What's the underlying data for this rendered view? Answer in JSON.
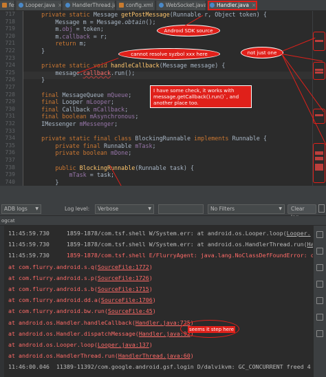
{
  "tabs": [
    {
      "label": "fest.xml",
      "icon": "xml-file-icon"
    },
    {
      "label": "Looper.java",
      "icon": "class-icon"
    },
    {
      "label": "HandlerThread.java",
      "icon": "class-icon"
    },
    {
      "label": "config.xml",
      "icon": "xml-file-icon"
    },
    {
      "label": "WebSocket.java",
      "icon": "class-icon"
    },
    {
      "label": "Handler.java",
      "icon": "class-icon",
      "active": true
    }
  ],
  "editor": {
    "line_numbers": [
      "717",
      "718",
      "719",
      "720",
      "721",
      "722",
      "723",
      "724",
      "725",
      "726",
      "727",
      "728",
      "729",
      "730",
      "731",
      "732",
      "733",
      "734",
      "735",
      "736",
      "737",
      "738",
      "739",
      "740"
    ],
    "lines": [
      [
        "    ",
        "kw:private static ",
        "Message ",
        "mth:getPostMessage",
        "(Runnable r, Object token) {"
      ],
      [
        "        Message m = Message.",
        "stat:obtain",
        "();"
      ],
      [
        "        m.",
        "fld:obj",
        " = token;"
      ],
      [
        "        m.",
        "fld:callback",
        " = r;"
      ],
      [
        "        ",
        "kw:return ",
        "m;"
      ],
      [
        "    }"
      ],
      [
        ""
      ],
      [
        "    ",
        "kw:private static void ",
        "mth:handleCallback",
        "(Message message) {"
      ],
      [
        "        message.",
        "err:callback",
        ".run();"
      ],
      [
        "    }"
      ],
      [
        ""
      ],
      [
        "    ",
        "kw:final ",
        "MessageQueue ",
        "fld:mQueue",
        ";"
      ],
      [
        "    ",
        "kw:final ",
        "Looper ",
        "fld:mLooper",
        ";"
      ],
      [
        "    ",
        "kw:final ",
        "Callback ",
        "fld:mCallback",
        ";"
      ],
      [
        "    ",
        "kw:final boolean ",
        "fld:mAsynchronous",
        ";"
      ],
      [
        "    IMessenger ",
        "fld:mMessenger",
        ";"
      ],
      [
        ""
      ],
      [
        "    ",
        "kw:private static final class ",
        "BlockingRunnable ",
        "kw:implements ",
        "Runnable {"
      ],
      [
        "        ",
        "kw:private final ",
        "Runnable ",
        "fld:mTask",
        ";"
      ],
      [
        "        ",
        "kw:private boolean ",
        "fld:mDone",
        ";"
      ],
      [
        ""
      ],
      [
        "        ",
        "kw:public ",
        "mth:BlockingRunnable",
        "(Runnable task) {"
      ],
      [
        "            ",
        "fld:mTask",
        " = task;"
      ],
      [
        "        }"
      ]
    ]
  },
  "annotations": {
    "sdk_source": "Android SDK source",
    "cannot_resolve": "cannot resolve syzbol xxx here",
    "not_just_one": "not just one",
    "explanation": "I have some check, it works with message.getCallback().run()`, and another place too.",
    "step_here": "seems it step here"
  },
  "toolbar": {
    "device_combo": "ADB logs",
    "log_level_label": "Log level:",
    "log_level_value": "Verbose",
    "filter_value": "No Filters",
    "clear_button": "Clear log"
  },
  "logcat": {
    "header": "ogcat",
    "rows": [
      {
        "ts": "11:45:59.730",
        "text": "     1859-1878/com.tsf.shell W/System.err: at android.os.Looper.loop(",
        "link": "Looper.",
        "style": "plain"
      },
      {
        "ts": "11:45:59.730",
        "text": "     1859-1878/com.tsf.shell W/System.err: at android.os.HandlerThread.run(",
        "link": "Handler",
        "style": "plain"
      },
      {
        "ts": "11:45:59.730",
        "text": "     1859-1878/com.tsf.shell E/FlurryAgent: java.lang.NoClassDefFoundError: c",
        "link": "",
        "style": "red"
      },
      {
        "ts": "",
        "text": "  at com.flurry.android.s.q(",
        "link": "SourceFile:1772",
        "tail": ")",
        "style": "red"
      },
      {
        "ts": "",
        "text": "  at com.flurry.android.s.p(",
        "link": "SourceFile:1726",
        "tail": ")",
        "style": "red"
      },
      {
        "ts": "",
        "text": "  at com.flurry.android.s.b(",
        "link": "SourceFile:1715",
        "tail": ")",
        "style": "red"
      },
      {
        "ts": "",
        "text": "  at com.flurry.android.dd.a(",
        "link": "SourceFile:1706",
        "tail": ")",
        "style": "red"
      },
      {
        "ts": "",
        "text": "  at com.flurry.android.bw.run(",
        "link": "SourceFile:45",
        "tail": ")",
        "style": "red"
      },
      {
        "ts": "",
        "text": "  at android.os.Handler.handleCallback(",
        "link": "Handler.java:725",
        "tail": ")",
        "style": "red"
      },
      {
        "ts": "",
        "text": "  at android.os.Handler.dispatchMessage(",
        "link": "Handler.java:92",
        "tail": ")",
        "style": "red"
      },
      {
        "ts": "",
        "text": "  at android.os.Looper.loop(",
        "link": "Looper.java:137",
        "tail": ")",
        "style": "red"
      },
      {
        "ts": "",
        "text": "  at android.os.HandlerThread.run(",
        "link": "HandlerThread.java:60",
        "tail": ")",
        "style": "red"
      },
      {
        "ts": "11:46:00.046",
        "text": "  11389-11392/com.google.android.gsf.login D/dalvikvm: GC_CONCURRENT freed 4",
        "link": "",
        "style": "plain"
      }
    ]
  }
}
